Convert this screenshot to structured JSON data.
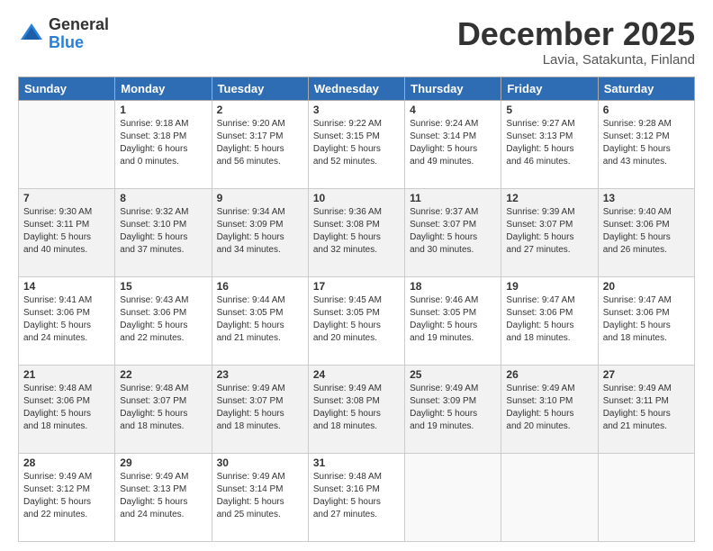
{
  "logo": {
    "general": "General",
    "blue": "Blue"
  },
  "title": "December 2025",
  "location": "Lavia, Satakunta, Finland",
  "weekdays": [
    "Sunday",
    "Monday",
    "Tuesday",
    "Wednesday",
    "Thursday",
    "Friday",
    "Saturday"
  ],
  "weeks": [
    [
      {
        "day": "",
        "info": ""
      },
      {
        "day": "1",
        "info": "Sunrise: 9:18 AM\nSunset: 3:18 PM\nDaylight: 6 hours\nand 0 minutes."
      },
      {
        "day": "2",
        "info": "Sunrise: 9:20 AM\nSunset: 3:17 PM\nDaylight: 5 hours\nand 56 minutes."
      },
      {
        "day": "3",
        "info": "Sunrise: 9:22 AM\nSunset: 3:15 PM\nDaylight: 5 hours\nand 52 minutes."
      },
      {
        "day": "4",
        "info": "Sunrise: 9:24 AM\nSunset: 3:14 PM\nDaylight: 5 hours\nand 49 minutes."
      },
      {
        "day": "5",
        "info": "Sunrise: 9:27 AM\nSunset: 3:13 PM\nDaylight: 5 hours\nand 46 minutes."
      },
      {
        "day": "6",
        "info": "Sunrise: 9:28 AM\nSunset: 3:12 PM\nDaylight: 5 hours\nand 43 minutes."
      }
    ],
    [
      {
        "day": "7",
        "info": "Sunrise: 9:30 AM\nSunset: 3:11 PM\nDaylight: 5 hours\nand 40 minutes."
      },
      {
        "day": "8",
        "info": "Sunrise: 9:32 AM\nSunset: 3:10 PM\nDaylight: 5 hours\nand 37 minutes."
      },
      {
        "day": "9",
        "info": "Sunrise: 9:34 AM\nSunset: 3:09 PM\nDaylight: 5 hours\nand 34 minutes."
      },
      {
        "day": "10",
        "info": "Sunrise: 9:36 AM\nSunset: 3:08 PM\nDaylight: 5 hours\nand 32 minutes."
      },
      {
        "day": "11",
        "info": "Sunrise: 9:37 AM\nSunset: 3:07 PM\nDaylight: 5 hours\nand 30 minutes."
      },
      {
        "day": "12",
        "info": "Sunrise: 9:39 AM\nSunset: 3:07 PM\nDaylight: 5 hours\nand 27 minutes."
      },
      {
        "day": "13",
        "info": "Sunrise: 9:40 AM\nSunset: 3:06 PM\nDaylight: 5 hours\nand 26 minutes."
      }
    ],
    [
      {
        "day": "14",
        "info": "Sunrise: 9:41 AM\nSunset: 3:06 PM\nDaylight: 5 hours\nand 24 minutes."
      },
      {
        "day": "15",
        "info": "Sunrise: 9:43 AM\nSunset: 3:06 PM\nDaylight: 5 hours\nand 22 minutes."
      },
      {
        "day": "16",
        "info": "Sunrise: 9:44 AM\nSunset: 3:05 PM\nDaylight: 5 hours\nand 21 minutes."
      },
      {
        "day": "17",
        "info": "Sunrise: 9:45 AM\nSunset: 3:05 PM\nDaylight: 5 hours\nand 20 minutes."
      },
      {
        "day": "18",
        "info": "Sunrise: 9:46 AM\nSunset: 3:05 PM\nDaylight: 5 hours\nand 19 minutes."
      },
      {
        "day": "19",
        "info": "Sunrise: 9:47 AM\nSunset: 3:06 PM\nDaylight: 5 hours\nand 18 minutes."
      },
      {
        "day": "20",
        "info": "Sunrise: 9:47 AM\nSunset: 3:06 PM\nDaylight: 5 hours\nand 18 minutes."
      }
    ],
    [
      {
        "day": "21",
        "info": "Sunrise: 9:48 AM\nSunset: 3:06 PM\nDaylight: 5 hours\nand 18 minutes."
      },
      {
        "day": "22",
        "info": "Sunrise: 9:48 AM\nSunset: 3:07 PM\nDaylight: 5 hours\nand 18 minutes."
      },
      {
        "day": "23",
        "info": "Sunrise: 9:49 AM\nSunset: 3:07 PM\nDaylight: 5 hours\nand 18 minutes."
      },
      {
        "day": "24",
        "info": "Sunrise: 9:49 AM\nSunset: 3:08 PM\nDaylight: 5 hours\nand 18 minutes."
      },
      {
        "day": "25",
        "info": "Sunrise: 9:49 AM\nSunset: 3:09 PM\nDaylight: 5 hours\nand 19 minutes."
      },
      {
        "day": "26",
        "info": "Sunrise: 9:49 AM\nSunset: 3:10 PM\nDaylight: 5 hours\nand 20 minutes."
      },
      {
        "day": "27",
        "info": "Sunrise: 9:49 AM\nSunset: 3:11 PM\nDaylight: 5 hours\nand 21 minutes."
      }
    ],
    [
      {
        "day": "28",
        "info": "Sunrise: 9:49 AM\nSunset: 3:12 PM\nDaylight: 5 hours\nand 22 minutes."
      },
      {
        "day": "29",
        "info": "Sunrise: 9:49 AM\nSunset: 3:13 PM\nDaylight: 5 hours\nand 24 minutes."
      },
      {
        "day": "30",
        "info": "Sunrise: 9:49 AM\nSunset: 3:14 PM\nDaylight: 5 hours\nand 25 minutes."
      },
      {
        "day": "31",
        "info": "Sunrise: 9:48 AM\nSunset: 3:16 PM\nDaylight: 5 hours\nand 27 minutes."
      },
      {
        "day": "",
        "info": ""
      },
      {
        "day": "",
        "info": ""
      },
      {
        "day": "",
        "info": ""
      }
    ]
  ]
}
